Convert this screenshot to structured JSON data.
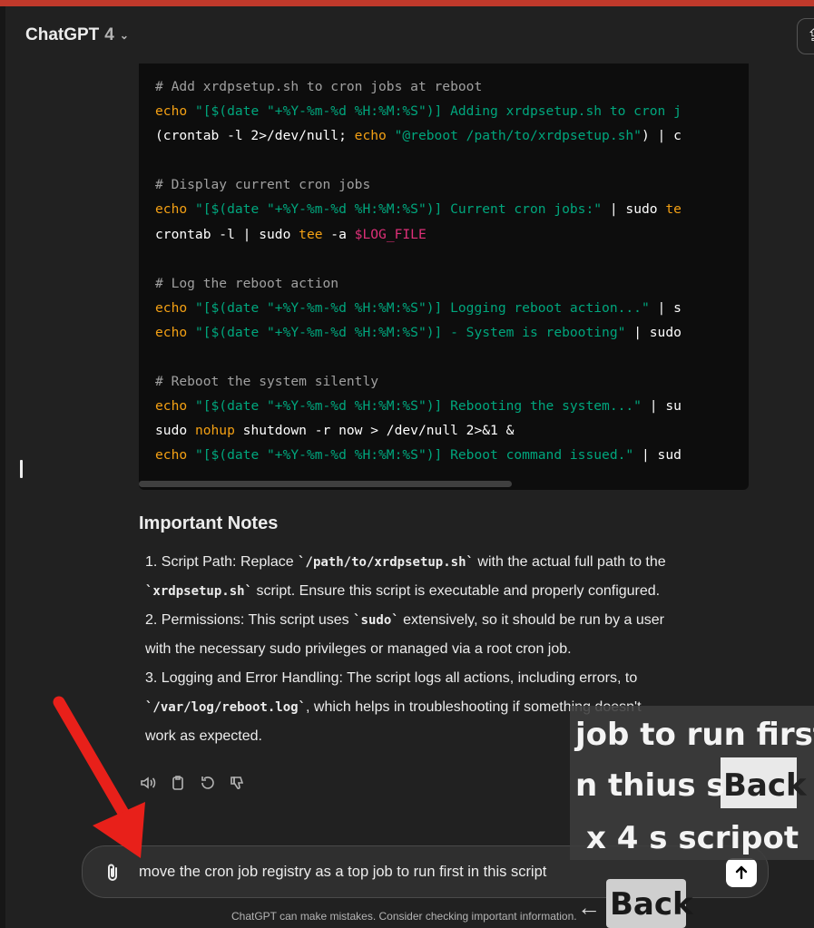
{
  "header": {
    "model_name": "ChatGPT",
    "model_version": "4"
  },
  "code_lines": [
    [
      {
        "t": "# Add xrdpsetup.sh to cron jobs at reboot",
        "c": "com"
      }
    ],
    [
      {
        "t": "echo",
        "c": "kw"
      },
      {
        "t": " \"[$(date \"+%Y-%m-%d %H:%M:%S\")] Adding xrdpsetup.sh to cron j",
        "c": "str"
      }
    ],
    [
      {
        "t": "(crontab -l 2>/dev/null; ",
        "c": "pl"
      },
      {
        "t": "echo",
        "c": "kw"
      },
      {
        "t": " \"@reboot /path/to/xrdpsetup.sh\"",
        "c": "str"
      },
      {
        "t": ") | c",
        "c": "pl"
      }
    ],
    [],
    [
      {
        "t": "# Display current cron jobs",
        "c": "com"
      }
    ],
    [
      {
        "t": "echo",
        "c": "kw"
      },
      {
        "t": " \"[$(date \"+%Y-%m-%d %H:%M:%S\")] Current cron jobs:\"",
        "c": "str"
      },
      {
        "t": " | sudo ",
        "c": "pl"
      },
      {
        "t": "te",
        "c": "kw"
      }
    ],
    [
      {
        "t": "crontab -l | sudo ",
        "c": "pl"
      },
      {
        "t": "tee",
        "c": "kw"
      },
      {
        "t": " -a ",
        "c": "pl"
      },
      {
        "t": "$LOG_FILE",
        "c": "var"
      }
    ],
    [],
    [
      {
        "t": "# Log the reboot action",
        "c": "com"
      }
    ],
    [
      {
        "t": "echo",
        "c": "kw"
      },
      {
        "t": " \"[$(date \"+%Y-%m-%d %H:%M:%S\")] Logging reboot action...\"",
        "c": "str"
      },
      {
        "t": " | s",
        "c": "pl"
      }
    ],
    [
      {
        "t": "echo",
        "c": "kw"
      },
      {
        "t": " \"[$(date \"+%Y-%m-%d %H:%M:%S\")] - System is rebooting\"",
        "c": "str"
      },
      {
        "t": " | sudo",
        "c": "pl"
      }
    ],
    [],
    [
      {
        "t": "# Reboot the system silently",
        "c": "com"
      }
    ],
    [
      {
        "t": "echo",
        "c": "kw"
      },
      {
        "t": " \"[$(date \"+%Y-%m-%d %H:%M:%S\")] Rebooting the system...\"",
        "c": "str"
      },
      {
        "t": " | su",
        "c": "pl"
      }
    ],
    [
      {
        "t": "sudo ",
        "c": "pl"
      },
      {
        "t": "nohup",
        "c": "kw"
      },
      {
        "t": " shutdown -r now > /dev/null 2>&1 &",
        "c": "pl"
      }
    ],
    [
      {
        "t": "echo",
        "c": "kw"
      },
      {
        "t": " \"[$(date \"+%Y-%m-%d %H:%M:%S\")] Reboot command issued.\"",
        "c": "str"
      },
      {
        "t": " | sud",
        "c": "pl"
      }
    ]
  ],
  "notes": {
    "title": "Important Notes",
    "items": [
      {
        "line1_pre": "1. Script Path: Replace ",
        "line1_code": "`/path/to/xrdpsetup.sh`",
        "line1_post": " with the actual full path to the",
        "line2_code": "`xrdpsetup.sh`",
        "line2_post": " script. Ensure this script is executable and properly configured."
      },
      {
        "line1_pre": "2. Permissions: This script uses ",
        "line1_code": "`sudo`",
        "line1_post": " extensively, so it should be run by a user",
        "line2_post": "with the necessary sudo privileges or managed via a root cron job."
      },
      {
        "line1_pre": "3. Logging and Error Handling: The script logs all actions, including errors, to",
        "line2_code": "`/var/log/reboot.log`",
        "line2_post": ", which helps in troubleshooting if something doesn't",
        "line3": "work as expected."
      }
    ]
  },
  "actions": [
    "read-aloud-icon",
    "copy-icon",
    "regenerate-icon",
    "thumbs-down-icon"
  ],
  "composer": {
    "value": "move the cron job registry as a top job to run first in this script"
  },
  "disclaimer": "ChatGPT can make mistakes. Consider checking important information.",
  "overlay": {
    "line1": "job to run first",
    "line2_pre": "n thius s",
    "line2_back": "Back",
    "line3": "x 4 s scripot",
    "back_badge_arrow": "←",
    "back_badge_label": "Back"
  },
  "colors": {
    "accent_bar": "#c0392b",
    "annotation_arrow": "#e8201a",
    "code_keyword": "#f3a014",
    "code_string": "#00a67d",
    "code_variable": "#df3079"
  }
}
